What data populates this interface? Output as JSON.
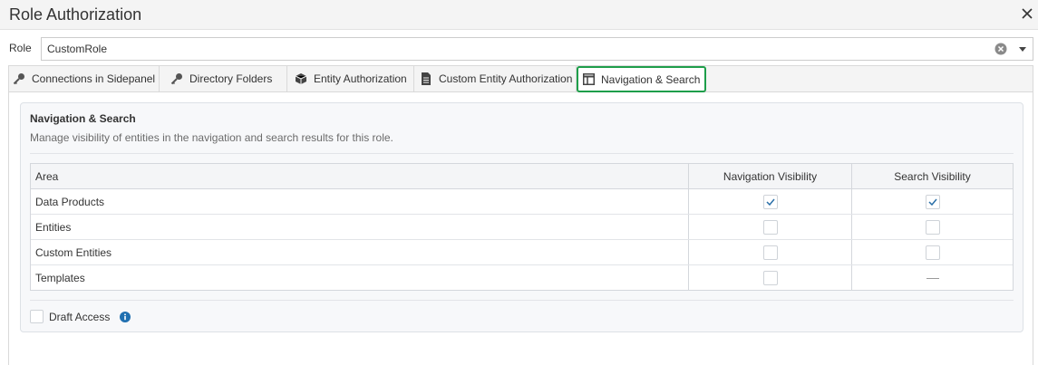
{
  "dialog": {
    "title": "Role Authorization"
  },
  "role": {
    "label": "Role",
    "value": "CustomRole"
  },
  "tabs": [
    {
      "label": "Connections in Sidepanel",
      "icon": "key-icon"
    },
    {
      "label": "Directory Folders",
      "icon": "key-icon"
    },
    {
      "label": "Entity Authorization",
      "icon": "cube-icon"
    },
    {
      "label": "Custom Entity Authorization",
      "icon": "document-icon"
    },
    {
      "label": "Navigation & Search",
      "icon": "layout-icon",
      "active": true
    }
  ],
  "panel": {
    "title": "Navigation & Search",
    "description": "Manage visibility of entities in the navigation and search results for this role."
  },
  "table": {
    "columns": [
      "Area",
      "Navigation Visibility",
      "Search Visibility"
    ],
    "rows": [
      {
        "area": "Data Products",
        "navigation": "checked",
        "search": "checked"
      },
      {
        "area": "Entities",
        "navigation": "unchecked",
        "search": "unchecked"
      },
      {
        "area": "Custom Entities",
        "navigation": "unchecked",
        "search": "unchecked"
      },
      {
        "area": "Templates",
        "navigation": "unchecked",
        "search": "not-applicable"
      }
    ]
  },
  "draft": {
    "label": "Draft Access",
    "checked": false,
    "icon": "info-icon"
  },
  "colors": {
    "active_tab_border": "#1e9e4a",
    "checkmark": "#2a6fa8",
    "info": "#1f6fb0"
  }
}
